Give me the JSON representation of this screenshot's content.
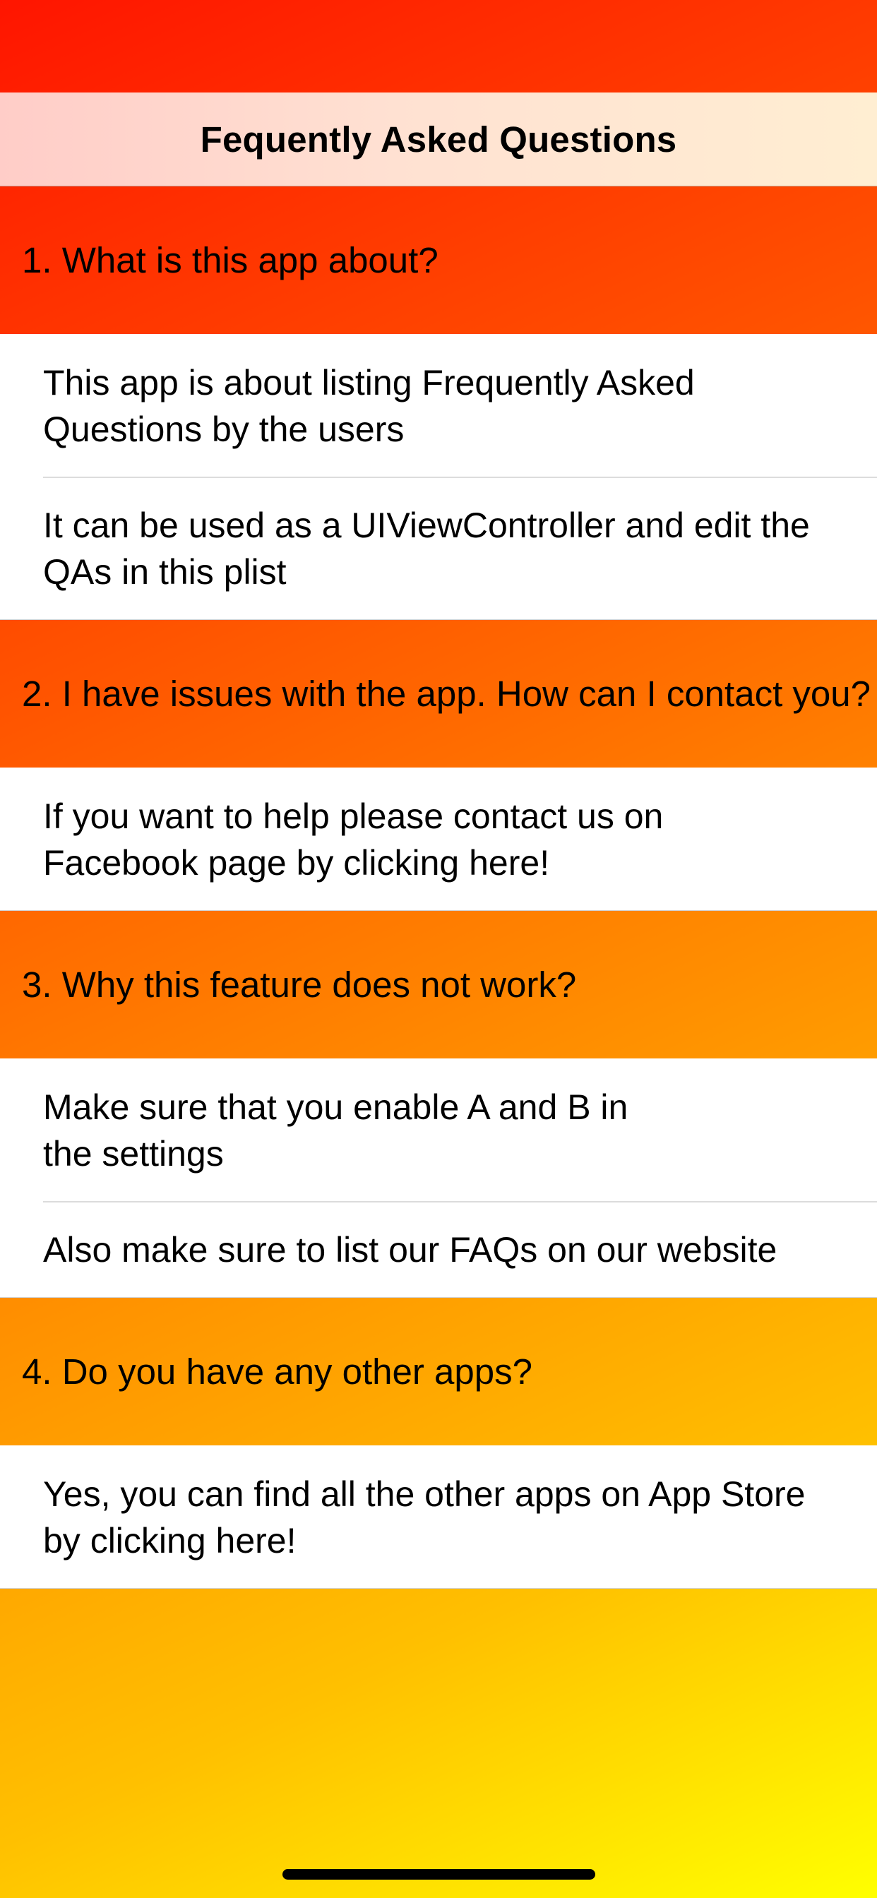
{
  "nav": {
    "title": "Fequently Asked Questions"
  },
  "faqs": [
    {
      "question": "1. What is this app about?",
      "answers": [
        [
          "This app is about listing Frequently Asked",
          "Questions by the users"
        ],
        [
          "It can be used as a UIViewController and edit the",
          "QAs in this plist"
        ]
      ]
    },
    {
      "question": "2. I have issues with the app. How can I contact you?",
      "answers": [
        [
          "If you want to help please contact us on",
          "Facebook page by clicking here!"
        ]
      ]
    },
    {
      "question": "3. Why this feature does not work?",
      "answers": [
        [
          "Make sure that you enable A and B in",
          "the settings"
        ],
        [
          "Also make sure to list our FAQs on our website"
        ]
      ]
    },
    {
      "question": "4. Do you have any other apps?",
      "answers": [
        [
          "Yes, you can find all the other apps on App Store",
          "by clicking here!"
        ]
      ]
    }
  ],
  "colors": {
    "gradient_start": "#ff1500",
    "gradient_end": "#ffff00",
    "answer_background": "#ffffff",
    "separator": "#dcdcdc"
  }
}
